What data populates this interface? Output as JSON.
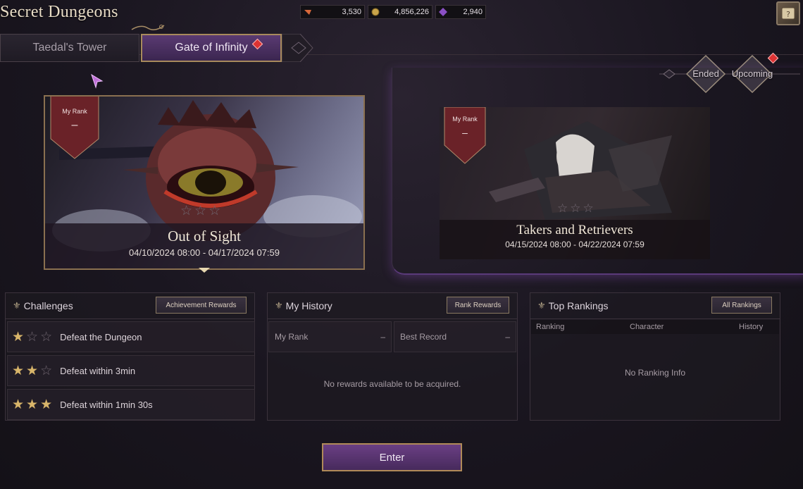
{
  "header": {
    "title": "Secret Dungeons",
    "currencies": [
      {
        "icon": "ticket-icon",
        "value": "3,530"
      },
      {
        "icon": "gold-coin-icon",
        "value": "4,856,226"
      },
      {
        "icon": "crystal-icon",
        "value": "2,940"
      }
    ]
  },
  "tabs": [
    {
      "label": "Taedal's Tower",
      "active": false
    },
    {
      "label": "Gate of Infinity",
      "active": true
    }
  ],
  "filters": {
    "ended": "Ended",
    "upcoming": "Upcoming"
  },
  "dungeons": [
    {
      "rank_label": "My Rank",
      "rank_value": "–",
      "name": "Out of Sight",
      "date": "04/10/2024 08:00 - 04/17/2024 07:59",
      "stars": 0
    },
    {
      "rank_label": "My Rank",
      "rank_value": "–",
      "name": "Takers and Retrievers",
      "date": "04/15/2024 08:00 - 04/22/2024 07:59",
      "stars": 0
    }
  ],
  "challenges": {
    "title": "Challenges",
    "button": "Achievement Rewards",
    "items": [
      {
        "stars": 1,
        "label": "Defeat the Dungeon"
      },
      {
        "stars": 2,
        "label": "Defeat within 3min"
      },
      {
        "stars": 3,
        "label": "Defeat within 1min 30s"
      }
    ]
  },
  "history": {
    "title": "My History",
    "button": "Rank Rewards",
    "my_rank_label": "My Rank",
    "my_rank_value": "–",
    "best_record_label": "Best Record",
    "best_record_value": "–",
    "empty": "No rewards available to be acquired."
  },
  "rankings": {
    "title": "Top Rankings",
    "button": "All Rankings",
    "columns": [
      "Ranking",
      "Character",
      "History"
    ],
    "empty": "No Ranking Info"
  },
  "enter_label": "Enter"
}
